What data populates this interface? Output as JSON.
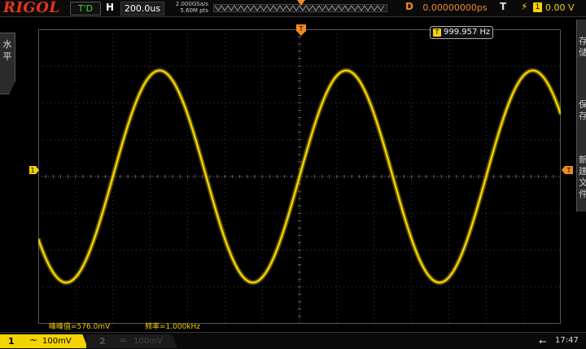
{
  "header": {
    "brand": "RIGOL",
    "run_state": "T'D",
    "horizontal_label": "H",
    "timebase": "200.0us",
    "sample_rate": "2.000GSa/s",
    "memory_depth": "5.60M pts",
    "delay_label": "D",
    "delay_value": "0.00000000ps",
    "trigger_label": "T",
    "trigger_channel": "1",
    "trigger_level": "0.00 V"
  },
  "side_menu": {
    "left_tab_line1": "水",
    "left_tab_line2": "平",
    "right_tabs": [
      "存",
      "储",
      "保",
      "存",
      "新",
      "建",
      "文",
      "件"
    ]
  },
  "display": {
    "freq_counter_icon": "T",
    "freq_counter": "999.957 Hz",
    "ch1_marker": "1",
    "trigger_level_marker": "T",
    "measurements": [
      {
        "label": "峰峰值=576.0mV"
      },
      {
        "label": "频率=1.000kHz"
      }
    ]
  },
  "footer": {
    "ch1_number": "1",
    "ch1_coupling": "~",
    "ch1_scale": "100mV",
    "ch2_number": "2",
    "ch2_coupling": "=",
    "ch2_scale": "100mV",
    "clock": "17:47"
  },
  "colors": {
    "ch1": "#f5d300",
    "trigger": "#f08a24",
    "grid": "#3a3a3a",
    "background": "#000000"
  },
  "chart_data": {
    "type": "line",
    "title": "",
    "xlabel": "",
    "ylabel": "",
    "grid": true,
    "time_per_div_us": 200,
    "volts_per_div_mV": 100,
    "x_divisions": 14,
    "y_divisions": 8,
    "xlim_us": [
      -1400,
      1400
    ],
    "ylim_mV": [
      -400,
      400
    ],
    "series": [
      {
        "shape": "sine",
        "frequency_hz": 999.957,
        "amplitude_mV": 288.0,
        "offset_mV": 0,
        "phase_deg": 0
      }
    ]
  }
}
